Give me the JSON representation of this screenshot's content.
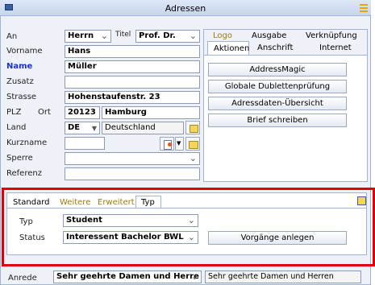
{
  "window": {
    "title": "Adressen"
  },
  "form": {
    "an_label": "An",
    "an_value": "Herrn",
    "titel_label": "Titel",
    "titel_value": "Prof. Dr.",
    "vorname_label": "Vorname",
    "vorname_value": "Hans",
    "name_label": "Name",
    "name_value": "Müller",
    "zusatz_label": "Zusatz",
    "zusatz_value": "",
    "strasse_label": "Strasse",
    "strasse_value": "Hohenstaufenstr. 23",
    "plz_label": "PLZ",
    "ort_label": "Ort",
    "plz_value": "20123",
    "ort_value": "Hamburg",
    "land_label": "Land",
    "land_code": "DE",
    "land_name": "Deutschland",
    "kurzname_label": "Kurzname",
    "kurzname_value": "",
    "sperre_label": "Sperre",
    "sperre_value": "",
    "referenz_label": "Referenz",
    "referenz_value": ""
  },
  "right_tabs": {
    "row1": [
      "Logo",
      "Ausgabe",
      "Verknüpfung"
    ],
    "row2": [
      "Aktionen",
      "Anschrift",
      "Internet"
    ]
  },
  "actions": [
    "AddressMagic",
    "Globale Dublettenprüfung",
    "Adressdaten-Übersicht",
    "Brief schreiben"
  ],
  "bottom_tabs": [
    "Standard",
    "Weitere",
    "Erweitert",
    "Typ"
  ],
  "typ_section": {
    "typ_label": "Typ",
    "typ_value": "Student",
    "status_label": "Status",
    "status_value": "Interessent Bachelor BWL",
    "vorgaenge_button": "Vorgänge anlegen"
  },
  "anrede": {
    "label": "Anrede",
    "value": "Sehr geehrte Damen und Herre",
    "text": "Sehr geehrte Damen und Herren"
  },
  "colors": {
    "highlight_box": "#e0000b",
    "name_label": "#1d33c8",
    "tab_gold": "#9b7a0c"
  },
  "icons": {
    "window": "window-icon",
    "menu": "menu-icon",
    "tab_corner": "export-icon",
    "kurzname_1": "edit-icon",
    "kurzname_2": "folder-icon"
  }
}
